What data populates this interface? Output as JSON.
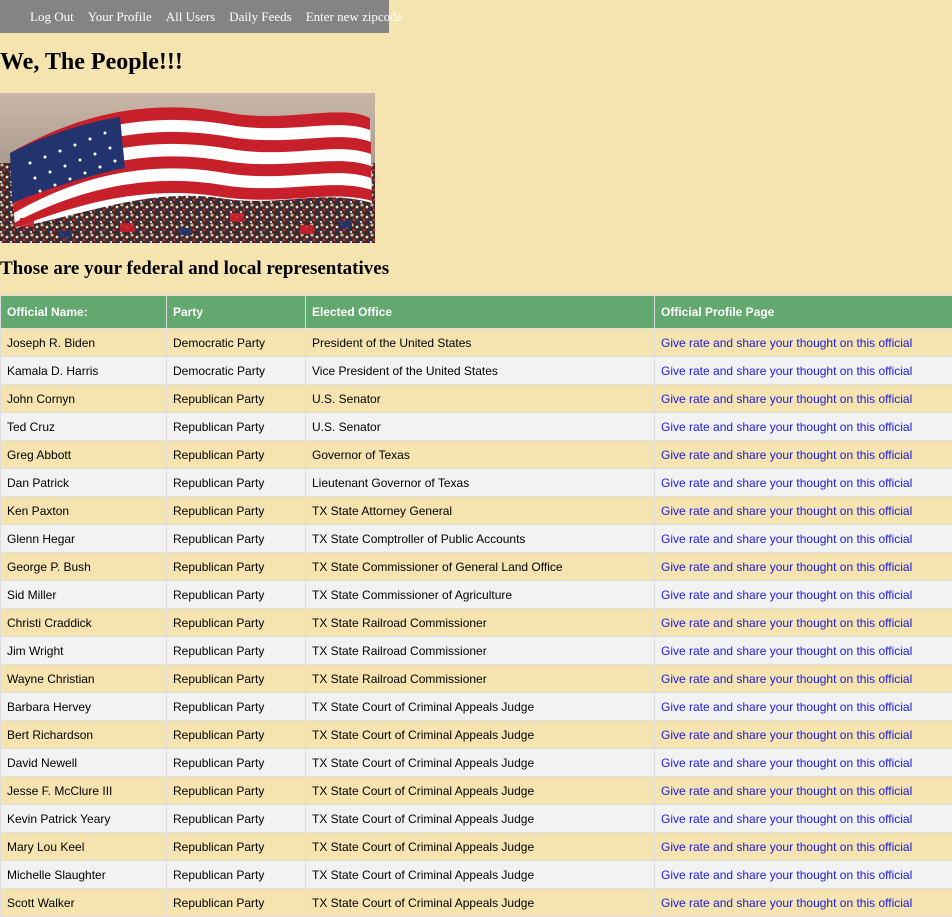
{
  "nav": {
    "items": [
      "Log Out",
      "Your Profile",
      "All Users",
      "Daily Feeds",
      "Enter new zipcode"
    ]
  },
  "page": {
    "title": "We, The People!!!",
    "subtitle": "Those are your federal and local representatives"
  },
  "colors": {
    "background": "#f5e4b0",
    "nav_bg": "#848484",
    "header_bg": "#63a86f",
    "row_alt": "#f2f2f2",
    "link": "#1a1ae6"
  },
  "table": {
    "headers": [
      "Official Name:",
      "Party",
      "Elected Office",
      "Official Profile Page"
    ],
    "link_text": "Give rate and share your thought on this official",
    "rows": [
      {
        "name": "Joseph R. Biden",
        "party": "Democratic Party",
        "office": "President of the United States"
      },
      {
        "name": "Kamala D. Harris",
        "party": "Democratic Party",
        "office": "Vice President of the United States"
      },
      {
        "name": "John Cornyn",
        "party": "Republican Party",
        "office": "U.S. Senator"
      },
      {
        "name": "Ted Cruz",
        "party": "Republican Party",
        "office": "U.S. Senator"
      },
      {
        "name": "Greg Abbott",
        "party": "Republican Party",
        "office": "Governor of Texas"
      },
      {
        "name": "Dan Patrick",
        "party": "Republican Party",
        "office": "Lieutenant Governor of Texas"
      },
      {
        "name": "Ken Paxton",
        "party": "Republican Party",
        "office": "TX State Attorney General"
      },
      {
        "name": "Glenn Hegar",
        "party": "Republican Party",
        "office": "TX State Comptroller of Public Accounts"
      },
      {
        "name": "George P. Bush",
        "party": "Republican Party",
        "office": "TX State Commissioner of General Land Office"
      },
      {
        "name": "Sid Miller",
        "party": "Republican Party",
        "office": "TX State Commissioner of Agriculture"
      },
      {
        "name": "Christi Craddick",
        "party": "Republican Party",
        "office": "TX State Railroad Commissioner"
      },
      {
        "name": "Jim Wright",
        "party": "Republican Party",
        "office": "TX State Railroad Commissioner"
      },
      {
        "name": "Wayne Christian",
        "party": "Republican Party",
        "office": "TX State Railroad Commissioner"
      },
      {
        "name": "Barbara Hervey",
        "party": "Republican Party",
        "office": "TX State Court of Criminal Appeals Judge"
      },
      {
        "name": "Bert Richardson",
        "party": "Republican Party",
        "office": "TX State Court of Criminal Appeals Judge"
      },
      {
        "name": "David Newell",
        "party": "Republican Party",
        "office": "TX State Court of Criminal Appeals Judge"
      },
      {
        "name": "Jesse F. McClure III",
        "party": "Republican Party",
        "office": "TX State Court of Criminal Appeals Judge"
      },
      {
        "name": "Kevin Patrick Yeary",
        "party": "Republican Party",
        "office": "TX State Court of Criminal Appeals Judge"
      },
      {
        "name": "Mary Lou Keel",
        "party": "Republican Party",
        "office": "TX State Court of Criminal Appeals Judge"
      },
      {
        "name": "Michelle Slaughter",
        "party": "Republican Party",
        "office": "TX State Court of Criminal Appeals Judge"
      },
      {
        "name": "Scott Walker",
        "party": "Republican Party",
        "office": "TX State Court of Criminal Appeals Judge"
      }
    ]
  }
}
